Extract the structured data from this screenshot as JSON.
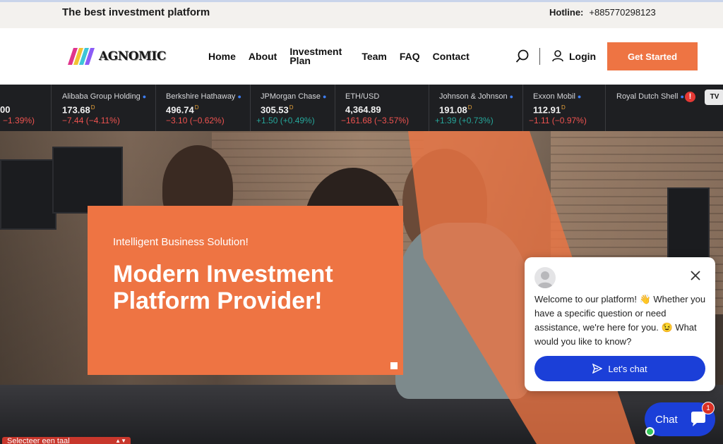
{
  "topbar": {
    "tagline": "The best investment platform",
    "hotline_label": "Hotline:",
    "hotline_number": "+885770298123"
  },
  "nav": {
    "logo_text": "AGNOMIC",
    "items": [
      "Home",
      "About",
      "Investment Plan",
      "Team",
      "FAQ",
      "Contact"
    ],
    "login_label": "Login",
    "cta_label": "Get Started"
  },
  "ticker": {
    "items": [
      {
        "name": "",
        "price": "00",
        "change": "−1.39%)",
        "dir": "down"
      },
      {
        "name": "Alibaba Group Holding",
        "price": "173.68",
        "change": "−7.44 (−4.11%)",
        "dir": "down"
      },
      {
        "name": "Berkshire Hathaway",
        "price": "496.74",
        "change": "−3.10 (−0.62%)",
        "dir": "down"
      },
      {
        "name": "JPMorgan Chase",
        "price": "305.53",
        "change": "+1.50 (+0.49%)",
        "dir": "up"
      },
      {
        "name": "ETH/USD",
        "price": "4,364.89",
        "change": "−161.68 (−3.57%)",
        "dir": "down"
      },
      {
        "name": "Johnson & Johnson",
        "price": "191.08",
        "change": "+1.39 (+0.73%)",
        "dir": "up"
      },
      {
        "name": "Exxon Mobil",
        "price": "112.91",
        "change": "−1.11 (−0.97%)",
        "dir": "down"
      },
      {
        "name": "Royal Dutch Shell",
        "price": "",
        "change": "",
        "dir": "down"
      }
    ],
    "price_suffix": "D",
    "tv_badge": "TV"
  },
  "hero": {
    "subtitle": "Intelligent Business Solution!",
    "title": "Modern Investment Platform Provider!"
  },
  "chat_popup": {
    "message": "Welcome to our platform! 👋 Whether you have a specific question or need assistance, we're here for you. 😉 What would you like to know?",
    "button_label": "Let's chat"
  },
  "chat_launcher": {
    "label": "Chat",
    "unread_count": "1"
  },
  "language_selector": {
    "label": "Selecteer een taal"
  },
  "colors": {
    "accent": "#ee7443",
    "chat_blue": "#1b3fd8",
    "ticker_bg": "#1e1f22",
    "down": "#ef5350",
    "up": "#26a69a"
  }
}
